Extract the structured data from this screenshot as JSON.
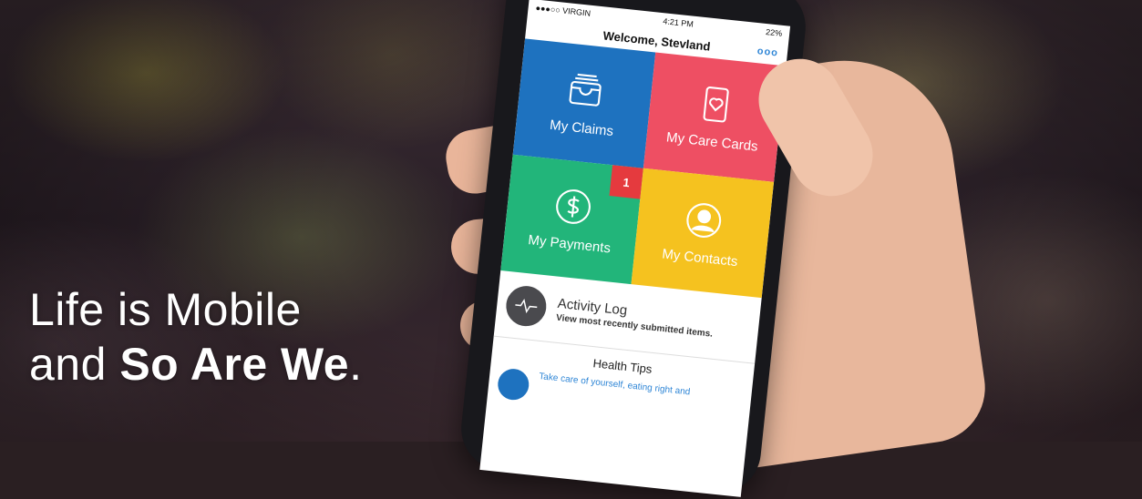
{
  "headline": {
    "line1": "Life is Mobile",
    "line2_prefix": "and ",
    "line2_bold": "So Are We",
    "line2_suffix": "."
  },
  "status_bar": {
    "carrier": "●●●○○ VIRGIN",
    "time": "4:21 PM",
    "battery": "22%"
  },
  "nav": {
    "title": "Welcome, Stevland",
    "more_label": "ooo"
  },
  "tiles": [
    {
      "label": "My Claims",
      "icon": "inbox-tray-icon",
      "color": "#1e72bf"
    },
    {
      "label": "My Care Cards",
      "icon": "heart-card-icon",
      "color": "#ee4f63"
    },
    {
      "label": "My Payments",
      "icon": "dollar-circle-icon",
      "color": "#22b57a",
      "badge": "1"
    },
    {
      "label": "My Contacts",
      "icon": "person-circle-icon",
      "color": "#f5c21f"
    }
  ],
  "activity": {
    "title": "Activity Log",
    "subtitle": "View most recently submitted items.",
    "icon": "pulse-icon"
  },
  "health_tips": {
    "title": "Health Tips",
    "text": "Take care of yourself, eating right and"
  }
}
